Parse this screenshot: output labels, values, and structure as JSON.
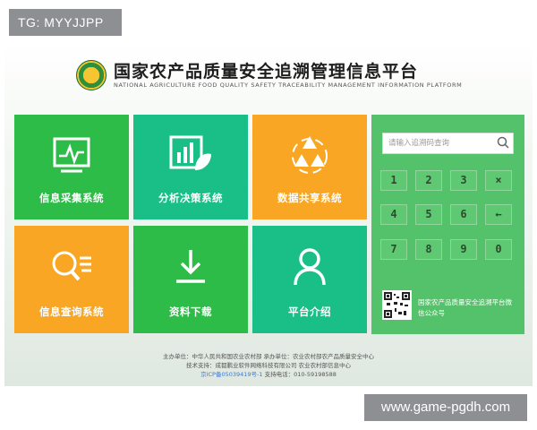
{
  "watermarks": {
    "top_left": "TG: MYYJJPP",
    "bottom_right": "www.game-pgdh.com"
  },
  "header": {
    "title_cn": "国家农产品质量安全追溯管理信息平台",
    "title_en": "NATIONAL AGRICULTURE FOOD QUALITY SAFETY TRACEABILITY MANAGEMENT INFORMATION PLATFORM"
  },
  "tiles": [
    {
      "label": "信息采集系统",
      "icon": "monitor-pulse-icon",
      "color": "#2cbc47"
    },
    {
      "label": "分析决策系统",
      "icon": "chart-leaf-icon",
      "color": "#19bf87"
    },
    {
      "label": "数据共享系统",
      "icon": "recycle-leaf-icon",
      "color": "#f8a623"
    },
    {
      "label": "信息查询系统",
      "icon": "search-list-icon",
      "color": "#f8a623"
    },
    {
      "label": "资料下载",
      "icon": "download-icon",
      "color": "#2cbc47"
    },
    {
      "label": "平台介绍",
      "icon": "user-icon",
      "color": "#19bf87"
    }
  ],
  "search": {
    "placeholder": "请输入追溯码查询"
  },
  "keypad": [
    "1",
    "2",
    "3",
    "×",
    "4",
    "5",
    "6",
    "←",
    "7",
    "8",
    "9",
    "0"
  ],
  "qr": {
    "caption": "国家农产品质量安全追溯平台微信公众号"
  },
  "footer": {
    "line1": "主办单位：中华人民共和国农业农村部   承办单位：农业农村部农产品质量安全中心",
    "line2": "技术支持：成都鹏业软件网络科技有限公司   农业农村部信息中心",
    "icp": "京ICP备05039419号-1",
    "phone": "支持电话：010-59198588"
  }
}
